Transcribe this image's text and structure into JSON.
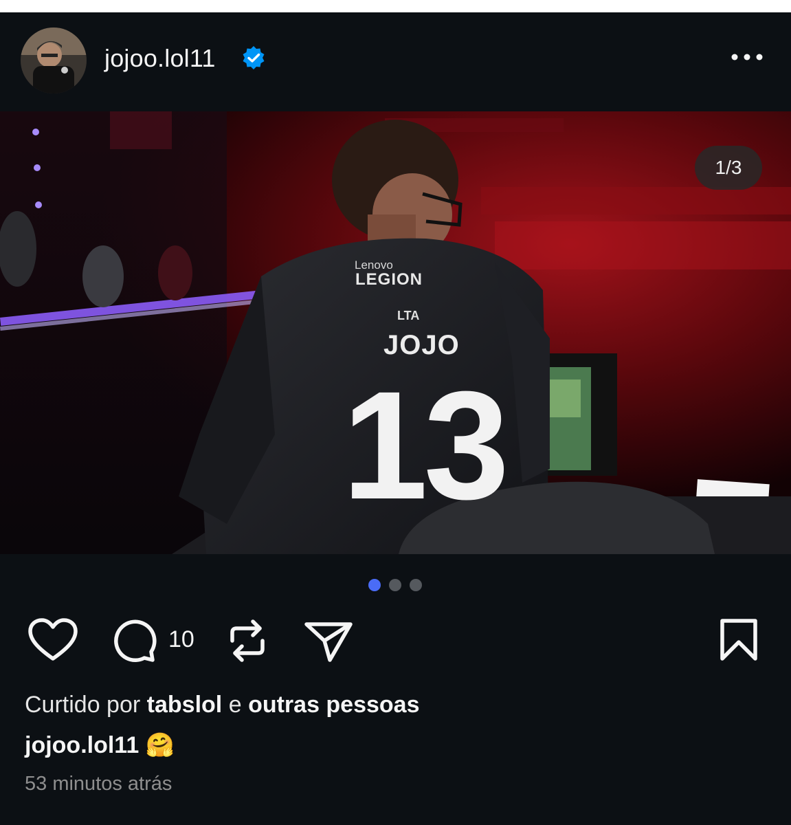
{
  "post": {
    "username": "jojoo.lol11",
    "image_counter": "1/3",
    "carousel": {
      "total": 3,
      "active_index": 0
    },
    "comments_count": "10",
    "liked": {
      "prefix": "Curtido por",
      "user": "tabslol",
      "connector": "e",
      "suffix": "outras pessoas"
    },
    "caption": {
      "username": "jojoo.lol11",
      "text": "🤗"
    },
    "timestamp": "53 minutos atrás"
  },
  "photo_text": {
    "sponsor_small": "Lenovo",
    "sponsor_big": "LEGION",
    "league": "LTA",
    "player_name": "JOJO",
    "jersey_number": "13"
  },
  "icons": {
    "more": "more-horizontal-icon",
    "verified": "verified-badge-icon",
    "like": "heart-icon",
    "comment": "comment-icon",
    "repost": "repost-icon",
    "share": "send-icon",
    "save": "bookmark-icon"
  },
  "colors": {
    "background": "#0c1014",
    "text": "#f5f5f5",
    "muted": "#8e8e8e",
    "verified": "#0095f6",
    "dot_active": "#4a6cf7"
  }
}
